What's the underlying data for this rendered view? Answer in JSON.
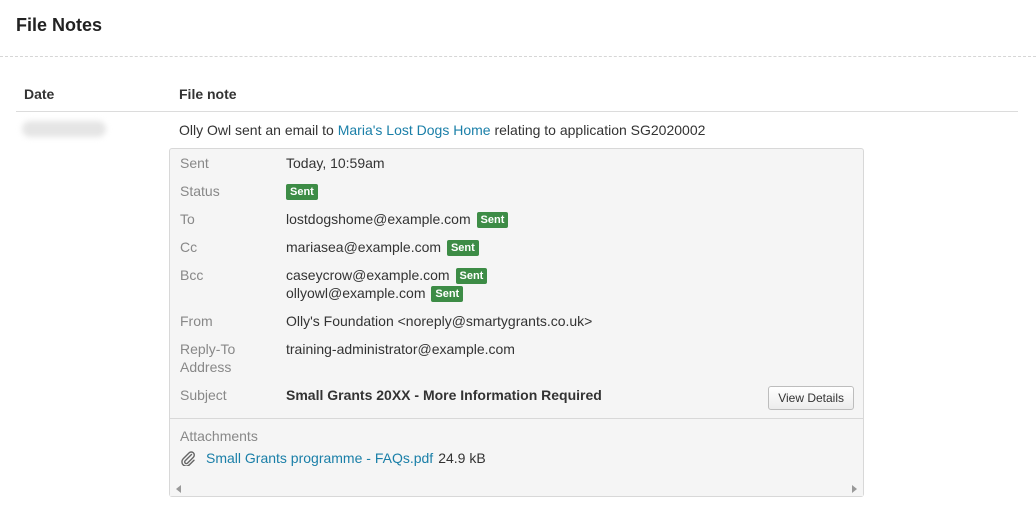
{
  "page": {
    "title": "File Notes"
  },
  "table": {
    "headers": {
      "date": "Date",
      "note": "File note"
    }
  },
  "note": {
    "prefix": "Olly Owl sent an email to ",
    "link": "Maria's Lost Dogs Home",
    "suffix": " relating to application SG2020002"
  },
  "email": {
    "sent": {
      "label": "Sent",
      "value": "Today, 10:59am"
    },
    "status": {
      "label": "Status",
      "badge": "Sent"
    },
    "to": {
      "label": "To",
      "value": "lostdogshome@example.com",
      "badge": "Sent"
    },
    "cc": {
      "label": "Cc",
      "value": "mariasea@example.com",
      "badge": "Sent"
    },
    "bcc": {
      "label": "Bcc",
      "values": [
        {
          "email": "caseycrow@example.com",
          "badge": "Sent"
        },
        {
          "email": "ollyowl@example.com",
          "badge": "Sent"
        }
      ]
    },
    "from": {
      "label": "From",
      "value": "Olly's Foundation <noreply@smartygrants.co.uk>"
    },
    "reply_to": {
      "label_line1": "Reply-To",
      "label_line2": "Address",
      "value": "training-administrator@example.com"
    },
    "subject": {
      "label": "Subject",
      "value": "Small Grants 20XX - More Information Required"
    },
    "view_details": "View Details",
    "attachments": {
      "label": "Attachments",
      "items": [
        {
          "name": "Small Grants programme - FAQs.pdf",
          "size": "24.9 kB",
          "icon": "paperclip-icon"
        }
      ]
    }
  },
  "colors": {
    "link": "#1a7fa8",
    "badge": "#3d8c46"
  }
}
